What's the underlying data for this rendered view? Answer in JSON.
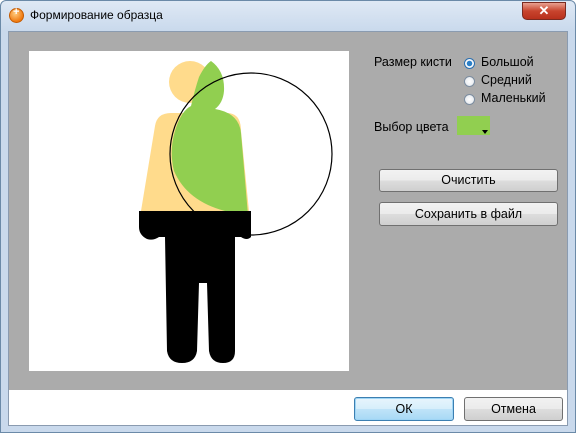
{
  "window": {
    "title": "Формирование образца",
    "close_label": "✕"
  },
  "brush": {
    "label": "Размер кисти",
    "options": [
      "Большой",
      "Средний",
      "Маленький"
    ],
    "selected": "Большой"
  },
  "color": {
    "label": "Выбор цвета",
    "value": "#91cf50"
  },
  "buttons": {
    "clear": "Очистить",
    "save": "Сохранить в файл",
    "ok": "ОК",
    "cancel": "Отмена"
  },
  "figure_colors": {
    "skin": "#ffdb8c",
    "paint": "#91cf50",
    "body": "#000000"
  }
}
